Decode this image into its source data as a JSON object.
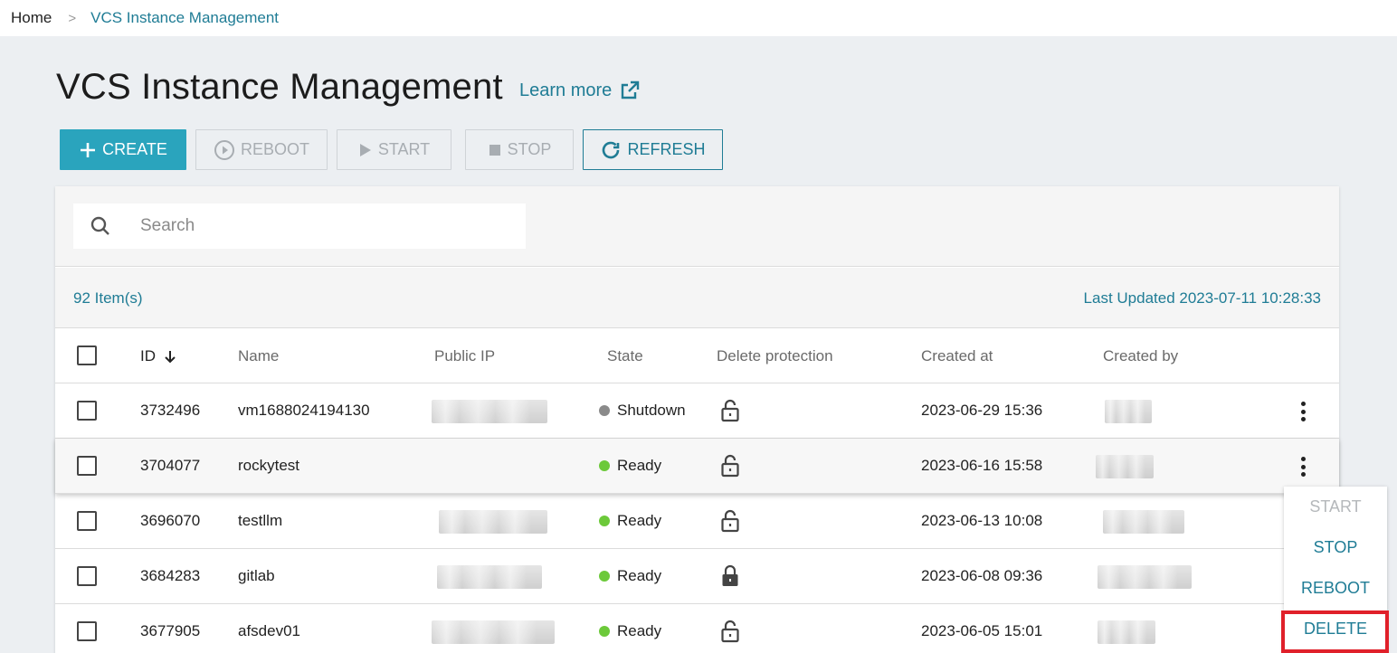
{
  "breadcrumb": {
    "home": "Home",
    "separator": ">",
    "current": "VCS Instance Management"
  },
  "header": {
    "title": "VCS Instance Management",
    "learn_more": "Learn more"
  },
  "toolbar": {
    "create": "CREATE",
    "reboot": "REBOOT",
    "start": "START",
    "stop": "STOP",
    "refresh": "REFRESH"
  },
  "search": {
    "placeholder": "Search",
    "value": ""
  },
  "info": {
    "item_count": "92 Item(s)",
    "last_updated": "Last Updated 2023-07-11 10:28:33"
  },
  "table": {
    "columns": {
      "id": "ID",
      "name": "Name",
      "public_ip": "Public IP",
      "state": "State",
      "delete_protection": "Delete protection",
      "created_at": "Created at",
      "created_by": "Created by"
    },
    "rows": [
      {
        "id": "3732496",
        "name": "vm1688024194130",
        "state": "Shutdown",
        "locked": false,
        "created_at": "2023-06-29 15:36"
      },
      {
        "id": "3704077",
        "name": "rockytest",
        "state": "Ready",
        "locked": false,
        "created_at": "2023-06-16 15:58"
      },
      {
        "id": "3696070",
        "name": "testllm",
        "state": "Ready",
        "locked": false,
        "created_at": "2023-06-13 10:08"
      },
      {
        "id": "3684283",
        "name": "gitlab",
        "state": "Ready",
        "locked": true,
        "created_at": "2023-06-08 09:36"
      },
      {
        "id": "3677905",
        "name": "afsdev01",
        "state": "Ready",
        "locked": false,
        "created_at": "2023-06-05 15:01"
      }
    ]
  },
  "context_menu": {
    "start": "START",
    "stop": "STOP",
    "reboot": "REBOOT",
    "delete": "DELETE"
  },
  "colors": {
    "accent": "#2aa4bd",
    "link": "#1f7c95",
    "ready": "#6cc93a",
    "shutdown": "#8a8a8a",
    "highlight": "#e0202a"
  }
}
